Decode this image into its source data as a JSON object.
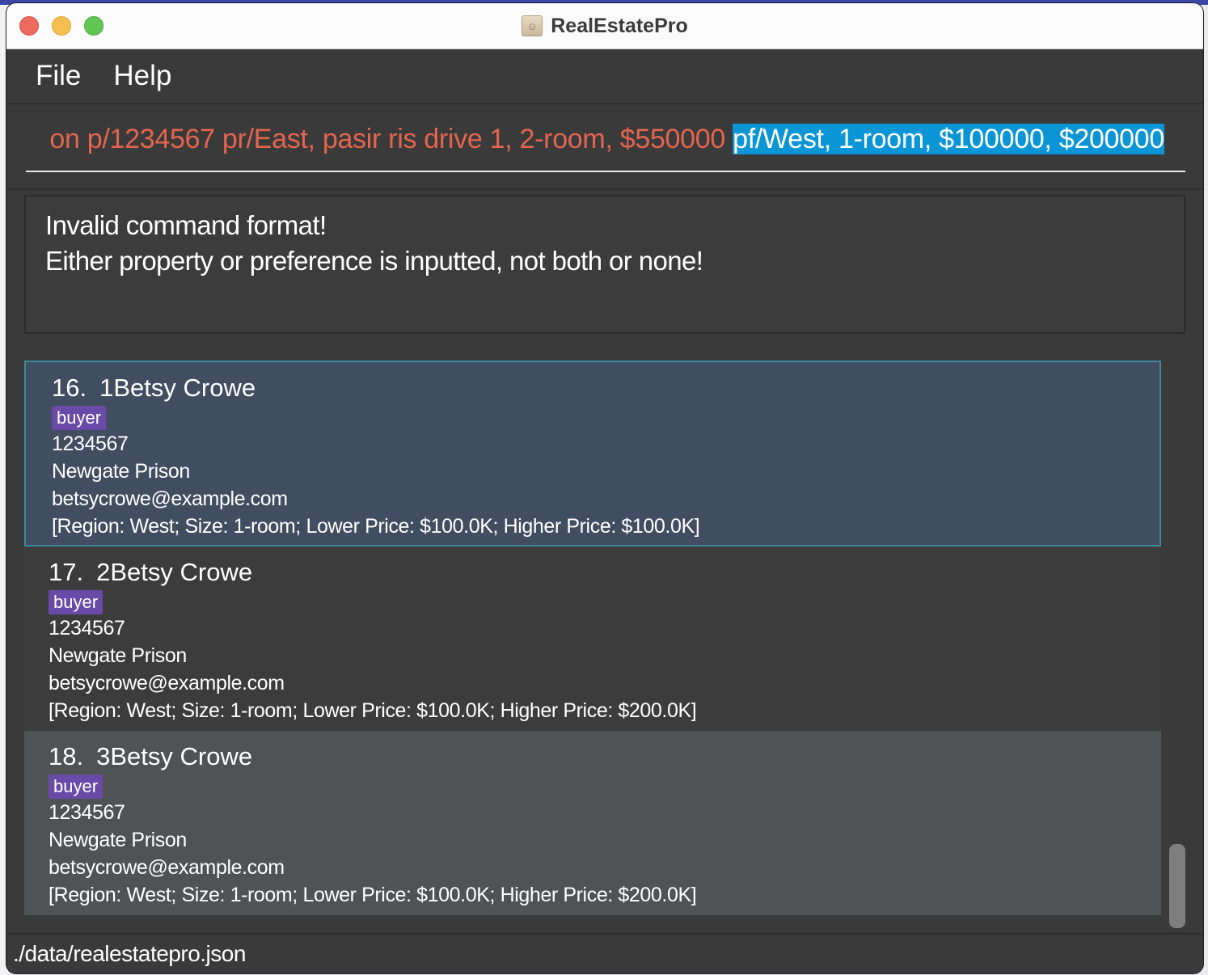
{
  "window": {
    "title": "RealEstatePro"
  },
  "menu": {
    "items": [
      {
        "label": "File"
      },
      {
        "label": "Help"
      }
    ]
  },
  "command": {
    "text_before_selection": "on p/1234567 pr/East, pasir ris drive 1, 2-room, $550000 ",
    "selected_text": "pf/West, 1-room, $100000, $200000"
  },
  "result": {
    "lines": [
      "Invalid command format!",
      "Either property or preference is inputted, not both or none!"
    ]
  },
  "persons": [
    {
      "index": "16.",
      "name": "1Betsy Crowe",
      "tag": "buyer",
      "phone": "1234567",
      "address": "Newgate Prison",
      "email": "betsycrowe@example.com",
      "preference": "[Region: West; Size: 1-room; Lower Price: $100.0K; Higher Price: $100.0K]"
    },
    {
      "index": "17.",
      "name": "2Betsy Crowe",
      "tag": "buyer",
      "phone": "1234567",
      "address": "Newgate Prison",
      "email": "betsycrowe@example.com",
      "preference": "[Region: West; Size: 1-room; Lower Price: $100.0K; Higher Price: $200.0K]"
    },
    {
      "index": "18.",
      "name": "3Betsy Crowe",
      "tag": "buyer",
      "phone": "1234567",
      "address": "Newgate Prison",
      "email": "betsycrowe@example.com",
      "preference": "[Region: West; Size: 1-room; Lower Price: $100.0K; Higher Price: $200.0K]"
    }
  ],
  "status": {
    "file_path": "./data/realestatepro.json"
  },
  "colors": {
    "command_text": "#e3654e",
    "selection_bg": "#0a95d6",
    "tag_bg": "#6a4aa8",
    "selected_card_bg": "#414d60",
    "selected_card_border": "#3c8ba0"
  },
  "icons": {
    "app_icon": "address-book-icon"
  }
}
